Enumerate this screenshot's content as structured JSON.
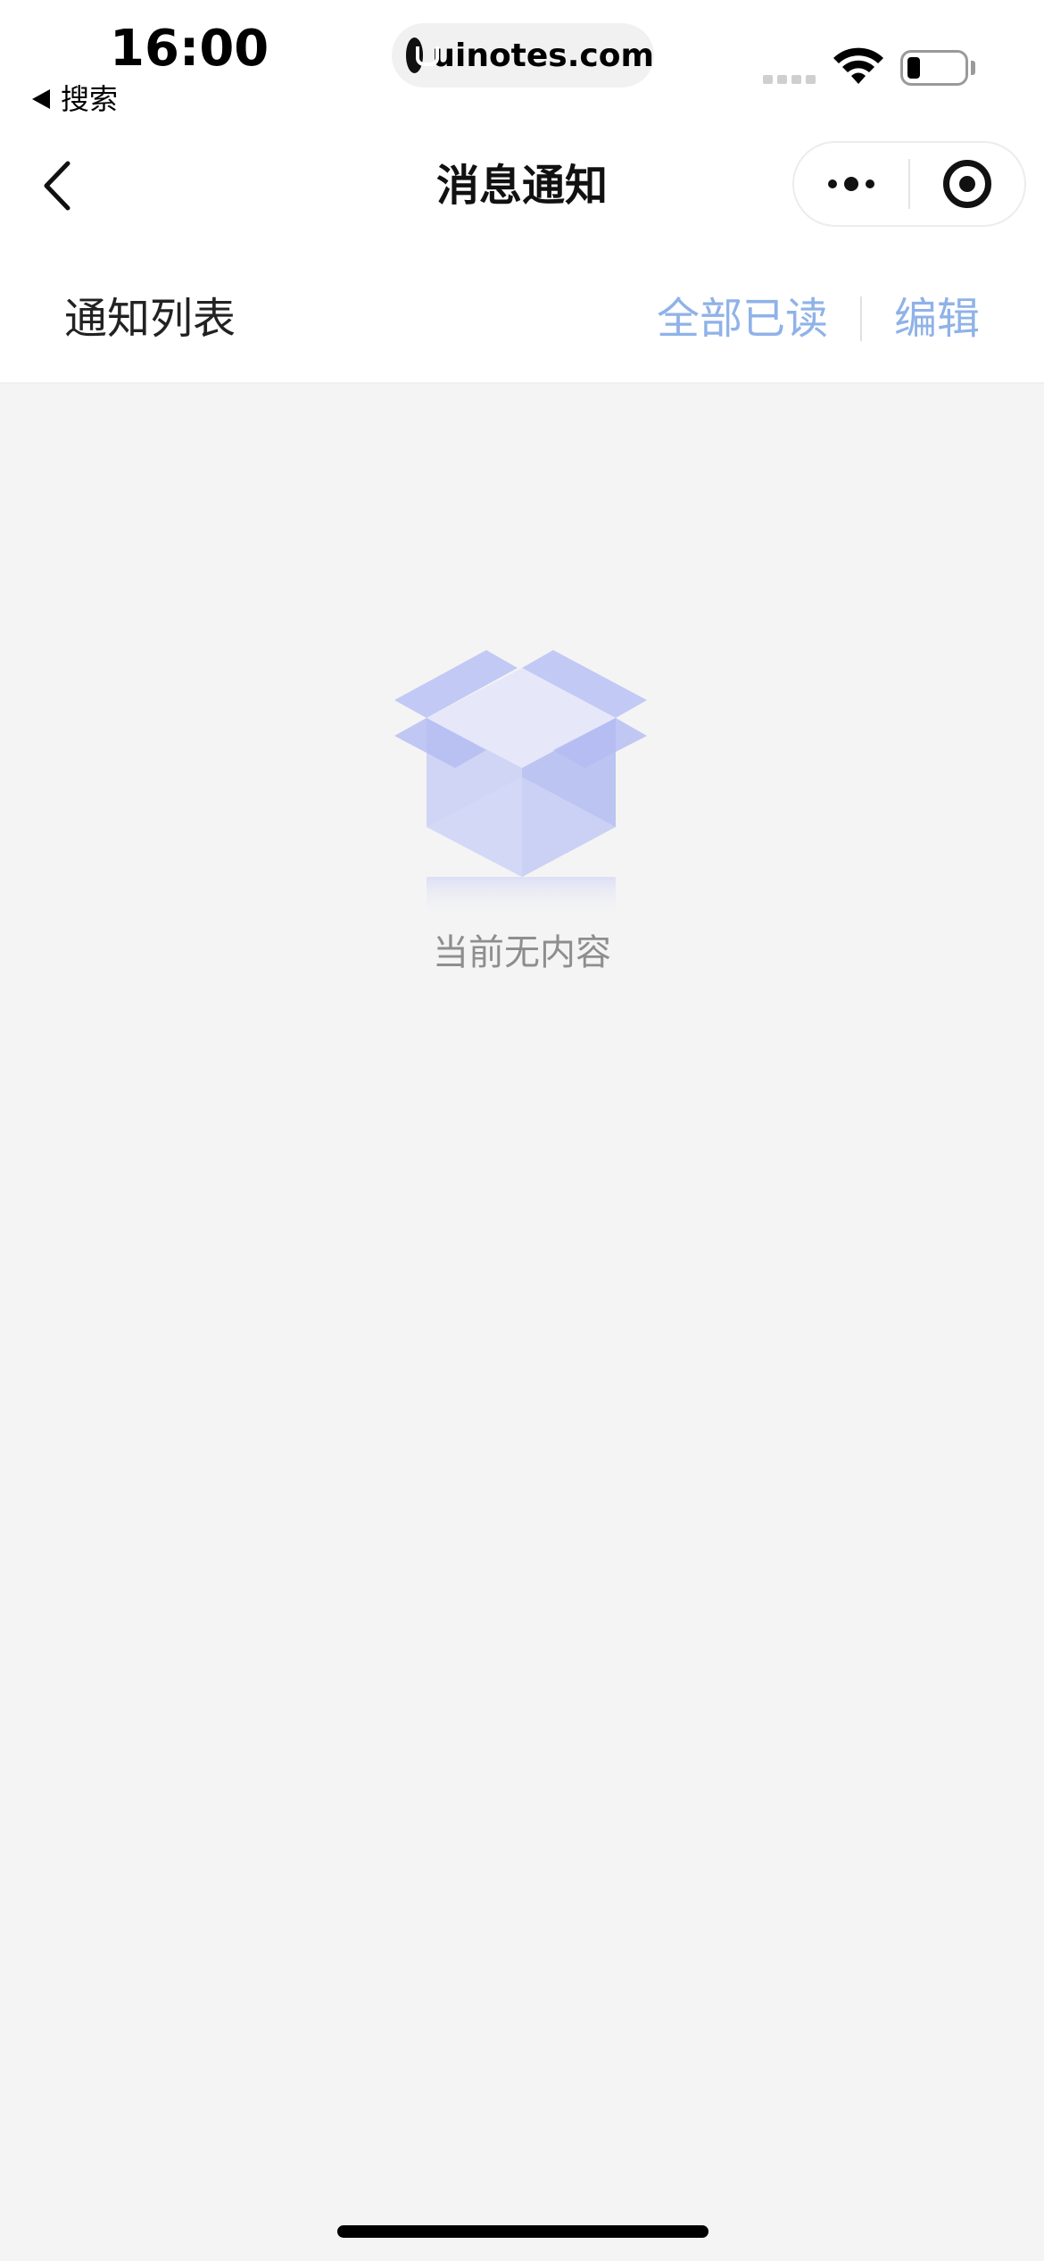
{
  "status_bar": {
    "time": "16:00",
    "back_app_label": "搜索",
    "url": "uinotes.com"
  },
  "nav": {
    "title": "消息通知"
  },
  "list_header": {
    "title": "通知列表",
    "mark_all_read": "全部已读",
    "edit": "编辑"
  },
  "empty_state": {
    "message": "当前无内容",
    "icon": "empty-box-icon"
  },
  "colors": {
    "accent_link": "#8fb2e8",
    "background": "#f4f4f4",
    "empty_icon": "#aab4f0"
  }
}
